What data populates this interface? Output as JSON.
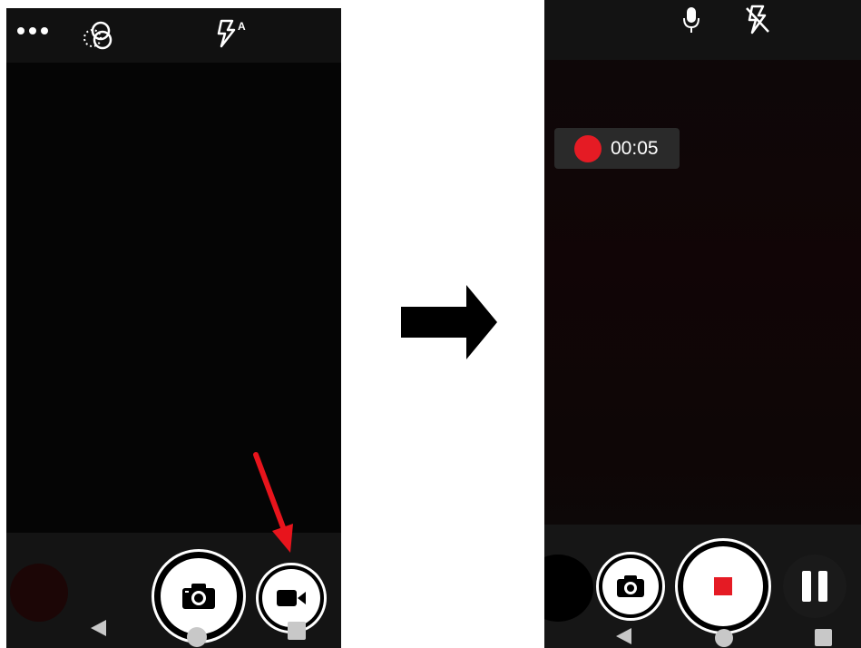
{
  "left_screen": {
    "icons": [
      "more-dots-icon",
      "filter-effects-icon",
      "flash-auto-icon",
      "camera-icon",
      "video-camera-icon",
      "back-nav-icon",
      "home-nav-icon",
      "recents-nav-icon"
    ],
    "annotation_color": "#e8141c"
  },
  "transition": {
    "icon": "right-arrow-icon"
  },
  "right_screen": {
    "recording_time": "00:05",
    "recording_color": "#e51b24",
    "stop_color": "#e51b24",
    "icons": [
      "microphone-icon",
      "flash-off-icon",
      "camera-icon",
      "stop-icon",
      "pause-icon",
      "back-nav-icon",
      "home-nav-icon",
      "recents-nav-icon"
    ]
  }
}
